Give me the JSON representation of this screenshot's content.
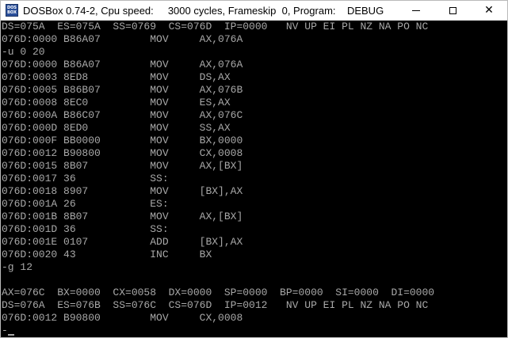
{
  "window": {
    "title": "DOSBox 0.74-2, Cpu speed:     3000 cycles, Frameskip  0, Program:    DEBUG",
    "icon": "dosbox-icon",
    "icon_text": [
      "DOS",
      "BOX"
    ]
  },
  "console": {
    "lines": [
      "DS=075A  ES=075A  SS=0769  CS=076D  IP=0000   NV UP EI PL NZ NA PO NC",
      "076D:0000 B86A07        MOV     AX,076A",
      "-u 0 20",
      "076D:0000 B86A07        MOV     AX,076A",
      "076D:0003 8ED8          MOV     DS,AX",
      "076D:0005 B86B07        MOV     AX,076B",
      "076D:0008 8EC0          MOV     ES,AX",
      "076D:000A B86C07        MOV     AX,076C",
      "076D:000D 8ED0          MOV     SS,AX",
      "076D:000F BB0000        MOV     BX,0000",
      "076D:0012 B90800        MOV     CX,0008",
      "076D:0015 8B07          MOV     AX,[BX]",
      "076D:0017 36            SS:",
      "076D:0018 8907          MOV     [BX],AX",
      "076D:001A 26            ES:",
      "076D:001B 8B07          MOV     AX,[BX]",
      "076D:001D 36            SS:",
      "076D:001E 0107          ADD     [BX],AX",
      "076D:0020 43            INC     BX",
      "-g 12",
      "",
      "AX=076C  BX=0000  CX=0058  DX=0000  SP=0000  BP=0000  SI=0000  DI=0000",
      "DS=076A  ES=076B  SS=076C  CS=076D  IP=0012   NV UP EI PL NZ NA PO NC",
      "076D:0012 B90800        MOV     CX,0008",
      "-"
    ]
  }
}
